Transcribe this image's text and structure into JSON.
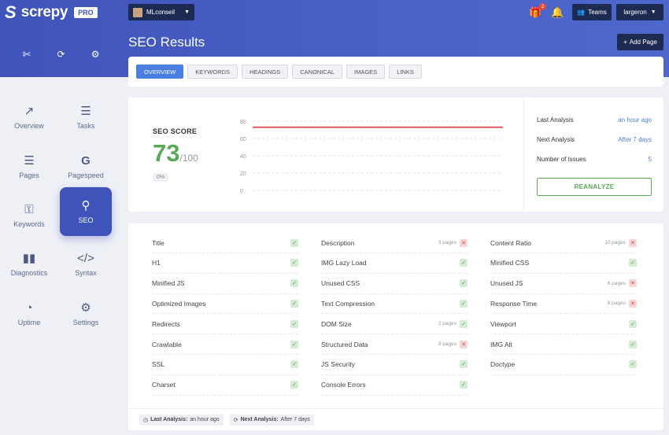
{
  "app": {
    "logo_mark": "S",
    "name": "screpy",
    "tier": "PRO"
  },
  "toolbar": {
    "icons": [
      "crop-icon",
      "refresh-icon",
      "settings-icon"
    ]
  },
  "header": {
    "project": "MLconseil",
    "gift_count": "2",
    "teams_label": "Teams",
    "user_label": "largeron",
    "title": "SEO Results",
    "add_page_label": "Add Page"
  },
  "sidebar": {
    "items": [
      {
        "label": "Overview",
        "icon": "chart-line-icon"
      },
      {
        "label": "Tasks",
        "icon": "checklist-icon"
      },
      {
        "label": "Pages",
        "icon": "list-icon"
      },
      {
        "label": "Pagespeed",
        "icon": "google-icon"
      },
      {
        "label": "Keywords",
        "icon": "key-icon"
      },
      {
        "label": "SEO",
        "icon": "search-icon"
      },
      {
        "label": "Diagnostics",
        "icon": "bar-chart-icon"
      },
      {
        "label": "Syntax",
        "icon": "code-icon"
      },
      {
        "label": "Uptime",
        "icon": "gauge-icon"
      },
      {
        "label": "Settings",
        "icon": "gear-icon"
      }
    ]
  },
  "tabs": [
    "OVERVIEW",
    "KEYWORDS",
    "HEADINGS",
    "CANONICAL",
    "IMAGES",
    "LINKS"
  ],
  "score": {
    "label": "SEO SCORE",
    "value": "73",
    "max": "/100",
    "change": "0%"
  },
  "chart_data": {
    "type": "line",
    "y_ticks": [
      "80",
      "60",
      "40",
      "20",
      "0"
    ],
    "ylim": [
      0,
      80
    ],
    "series": [
      {
        "values": [
          73,
          73
        ],
        "color": "#e05a5a"
      }
    ],
    "grid": true
  },
  "stats": {
    "last_analysis_label": "Last Analysis",
    "last_analysis_value": "an hour ago",
    "next_analysis_label": "Next Analysis",
    "next_analysis_value": "After 7 days",
    "issues_label": "Number of Issues",
    "issues_value": "5",
    "reanalyze_label": "REANALYZE"
  },
  "checks": {
    "col1": [
      {
        "label": "Title",
        "pages": "",
        "status": "ok"
      },
      {
        "label": "H1",
        "pages": "",
        "status": "ok"
      },
      {
        "label": "Minified JS",
        "pages": "",
        "status": "ok"
      },
      {
        "label": "Optimized Images",
        "pages": "",
        "status": "ok"
      },
      {
        "label": "Redirects",
        "pages": "",
        "status": "ok"
      },
      {
        "label": "Crawlable",
        "pages": "",
        "status": "ok"
      },
      {
        "label": "SSL",
        "pages": "",
        "status": "ok"
      },
      {
        "label": "Charset",
        "pages": "",
        "status": "ok"
      }
    ],
    "col2": [
      {
        "label": "Description",
        "pages": "3 pages",
        "status": "bad"
      },
      {
        "label": "IMG Lazy Load",
        "pages": "",
        "status": "ok"
      },
      {
        "label": "Unused CSS",
        "pages": "",
        "status": "ok"
      },
      {
        "label": "Text Compression",
        "pages": "",
        "status": "ok"
      },
      {
        "label": "DOM Size",
        "pages": "2 pages",
        "status": "ok"
      },
      {
        "label": "Structured Data",
        "pages": "9 pages",
        "status": "bad"
      },
      {
        "label": "JS Security",
        "pages": "",
        "status": "ok"
      },
      {
        "label": "Console Errors",
        "pages": "",
        "status": "ok"
      }
    ],
    "col3": [
      {
        "label": "Content Ratio",
        "pages": "10 pages",
        "status": "bad"
      },
      {
        "label": "Minified CSS",
        "pages": "",
        "status": "ok"
      },
      {
        "label": "Unused JS",
        "pages": "6 pages",
        "status": "bad"
      },
      {
        "label": "Response Time",
        "pages": "8 pages",
        "status": "bad"
      },
      {
        "label": "Viewport",
        "pages": "",
        "status": "ok"
      },
      {
        "label": "IMG Alt",
        "pages": "",
        "status": "ok"
      },
      {
        "label": "Doctype",
        "pages": "",
        "status": "ok"
      }
    ]
  },
  "footer": {
    "last_label": "Last Analysis:",
    "last_value": "an hour ago",
    "next_label": "Next Analysis:",
    "next_value": "After 7 days"
  }
}
